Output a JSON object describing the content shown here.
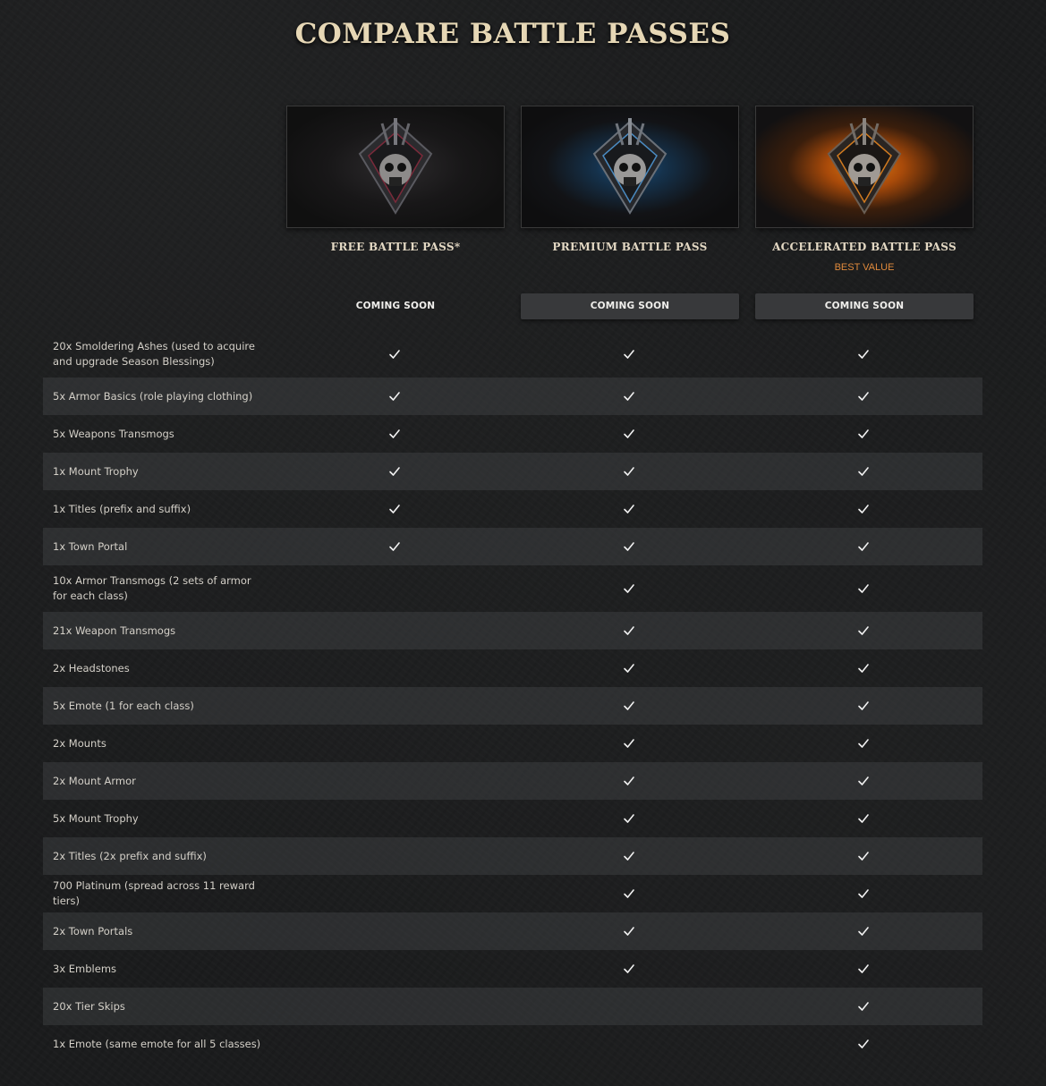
{
  "page": {
    "title": "COMPARE BATTLE PASSES"
  },
  "passes": [
    {
      "name": "FREE BATTLE PASS*",
      "cta": "COMING SOON",
      "icon": "skull-emblem-icon",
      "best_value": ""
    },
    {
      "name": "PREMIUM BATTLE PASS",
      "cta": "COMING SOON",
      "icon": "skull-emblem-blue-icon",
      "best_value": ""
    },
    {
      "name": "ACCELERATED BATTLE PASS",
      "cta": "COMING SOON",
      "icon": "skull-emblem-orange-icon",
      "best_value": "BEST VALUE"
    }
  ],
  "colors": {
    "best_value": "#e08a3c",
    "title": "#e6d7b5",
    "premium_glow": "#1d5a8c",
    "accelerated_glow": "#e07a10"
  },
  "features": [
    {
      "label": "20x Smoldering Ashes (used to acquire and upgrade Season Blessings)",
      "free": true,
      "premium": true,
      "accelerated": true
    },
    {
      "label": "5x Armor Basics (role playing clothing)",
      "free": true,
      "premium": true,
      "accelerated": true
    },
    {
      "label": "5x Weapons Transmogs",
      "free": true,
      "premium": true,
      "accelerated": true
    },
    {
      "label": "1x Mount Trophy",
      "free": true,
      "premium": true,
      "accelerated": true
    },
    {
      "label": "1x Titles (prefix and suffix)",
      "free": true,
      "premium": true,
      "accelerated": true
    },
    {
      "label": "1x Town Portal",
      "free": true,
      "premium": true,
      "accelerated": true
    },
    {
      "label": "10x Armor Transmogs (2 sets of armor for each class)",
      "free": false,
      "premium": true,
      "accelerated": true
    },
    {
      "label": "21x Weapon Transmogs",
      "free": false,
      "premium": true,
      "accelerated": true
    },
    {
      "label": "2x Headstones",
      "free": false,
      "premium": true,
      "accelerated": true
    },
    {
      "label": "5x Emote (1 for each class)",
      "free": false,
      "premium": true,
      "accelerated": true
    },
    {
      "label": "2x Mounts",
      "free": false,
      "premium": true,
      "accelerated": true
    },
    {
      "label": "2x Mount Armor",
      "free": false,
      "premium": true,
      "accelerated": true
    },
    {
      "label": "5x Mount Trophy",
      "free": false,
      "premium": true,
      "accelerated": true
    },
    {
      "label": "2x Titles (2x prefix and suffix)",
      "free": false,
      "premium": true,
      "accelerated": true
    },
    {
      "label": "700 Platinum (spread across 11 reward tiers)",
      "free": false,
      "premium": true,
      "accelerated": true
    },
    {
      "label": "2x Town Portals",
      "free": false,
      "premium": true,
      "accelerated": true
    },
    {
      "label": "3x Emblems",
      "free": false,
      "premium": true,
      "accelerated": true
    },
    {
      "label": "20x Tier Skips",
      "free": false,
      "premium": false,
      "accelerated": true
    },
    {
      "label": "1x Emote (same emote for all 5 classes)",
      "free": false,
      "premium": false,
      "accelerated": true
    }
  ]
}
